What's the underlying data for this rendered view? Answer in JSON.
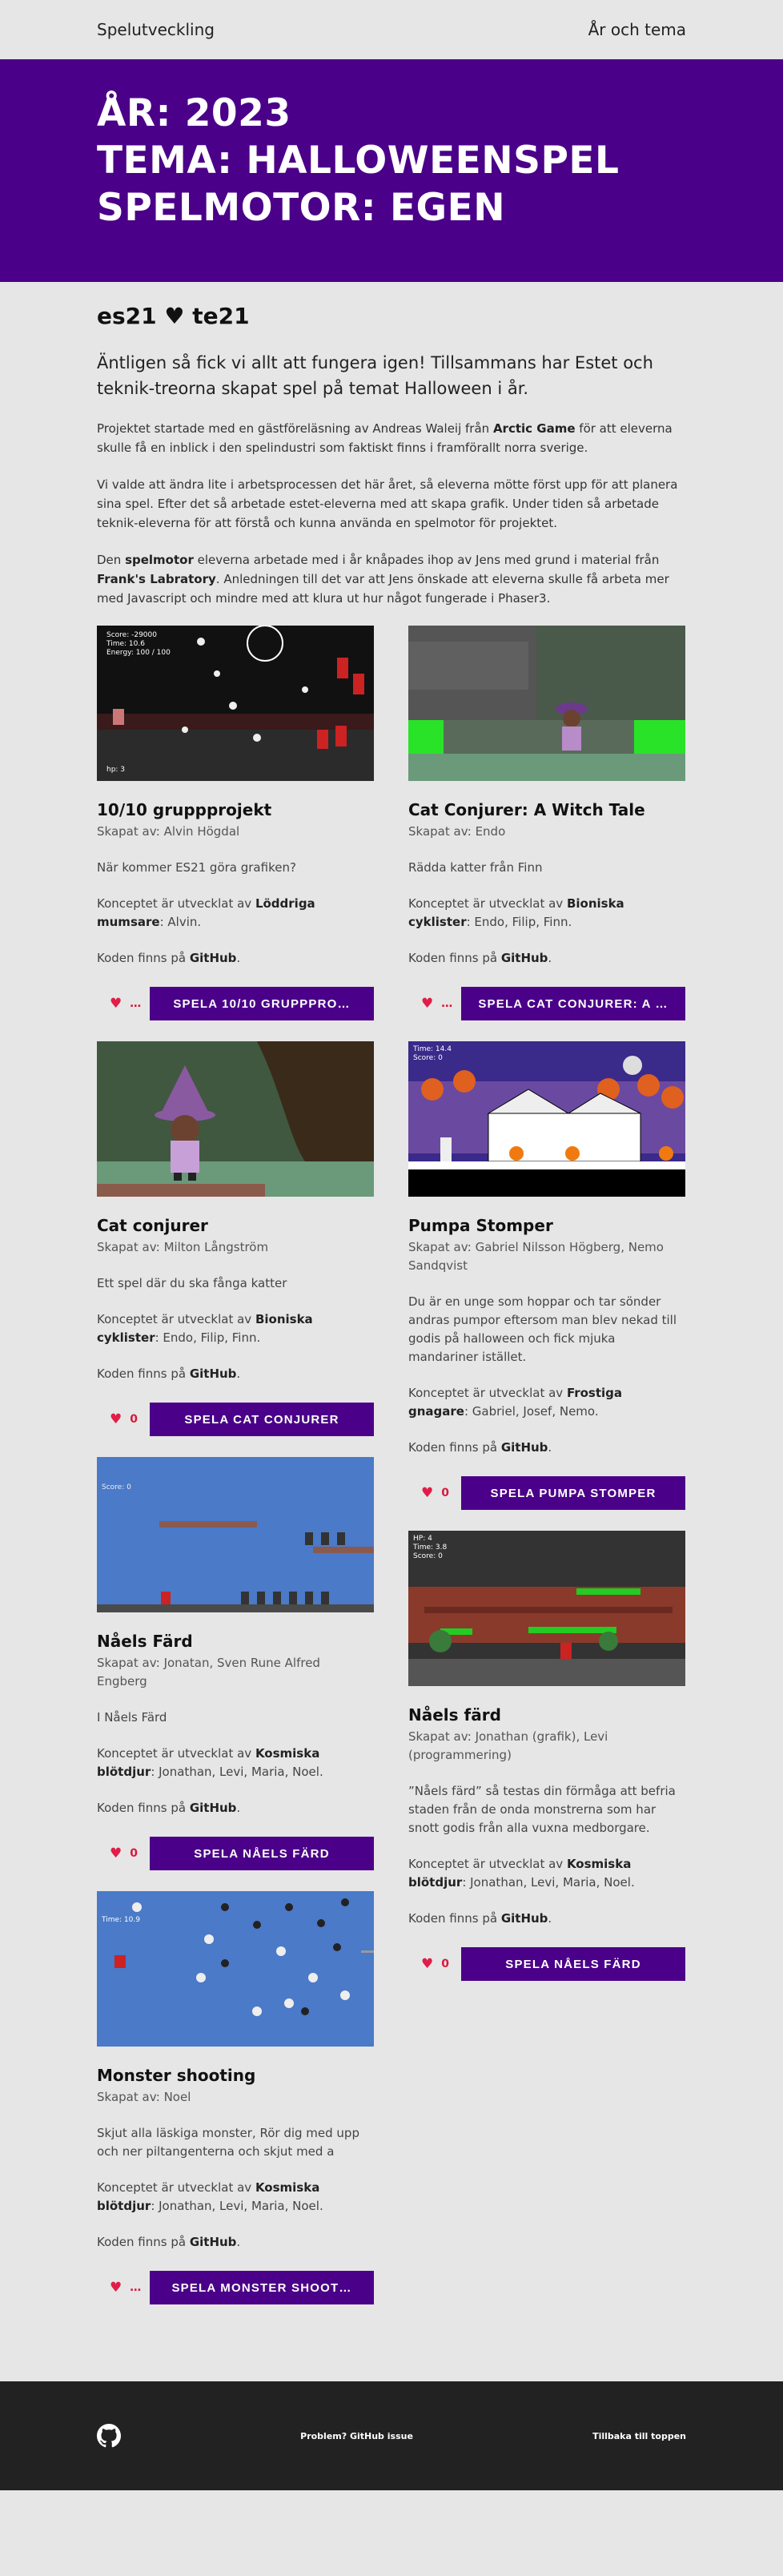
{
  "nav": {
    "brand": "Spelutveckling",
    "link": "År och tema"
  },
  "hero": {
    "line1": "ÅR: 2023",
    "line2": "TEMA: HALLOWEENSPEL",
    "line3": "SPELMOTOR: EGEN"
  },
  "intro": {
    "org": "es21 ♥ te21",
    "lead": "Äntligen så fick vi allt att fungera igen! Tillsammans har Estet och teknik-treorna skapat spel på temat Halloween i år.",
    "p1_a": "Projektet startade med en gästföreläsning av Andreas Waleij från ",
    "p1_b": "Arctic Game",
    "p1_c": " för att eleverna skulle få en inblick i den spelindustri som faktiskt finns i framförallt norra sverige.",
    "p2": "Vi valde att ändra lite i arbetsprocessen det här året, så eleverna möttе först upp för att planera sina spel. Efter det så arbetade estet-eleverna med att skapa grafik. Under tiden så arbetade teknik-eleverna för att förstå och kunna använda en spelmotor för projektet.",
    "p3_a": "Den ",
    "p3_b": "spelmotor",
    "p3_c": " eleverna arbetade med i år knåpades ihop av Jens med grund i material från ",
    "p3_d": "Frank's Labratory",
    "p3_e": ". Anledningen till det var att Jens önskade att eleverna skulle få arbeta mer med Javascript och mindre med att klura ut hur något fungerade i Phaser3."
  },
  "games": [
    {
      "title": "10/10 gruppprojekt",
      "author": "Skapat av: Alvin Högdal",
      "desc": "När kommer ES21 göra grafiken?",
      "concept_pre": "Konceptet är utvecklat av ",
      "concept_group": "Löddriga mumsare",
      "concept_names": ": Alvin.",
      "code_pre": "Koden finns på ",
      "code_link": "GitHub",
      "code_post": ".",
      "likes": "…",
      "play": "SPELA 10/10 GRUPPPRO…",
      "thumb_text": [
        "Score: -29000",
        "Time: 10.6",
        "Energy: 100 / 100",
        "hp: 3"
      ]
    },
    {
      "title": "Cat Conjurer: A Witch Tale",
      "author": "Skapat av: Endo",
      "desc": "Rädda katter från Finn",
      "concept_pre": "Konceptet är utvecklat av ",
      "concept_group": "Bioniska cyklister",
      "concept_names": ": Endo, Filip, Finn.",
      "code_pre": "Koden finns på ",
      "code_link": "GitHub",
      "code_post": ".",
      "likes": "…",
      "play": "SPELA CAT CONJURER: A …",
      "thumb_text": []
    },
    {
      "title": "Cat conjurer",
      "author": "Skapat av: Milton Långström",
      "desc": "Ett spel där du ska fånga katter",
      "concept_pre": "Konceptet är utvecklat av ",
      "concept_group": "Bioniska cyklister",
      "concept_names": ": Endo, Filip, Finn.",
      "code_pre": "Koden finns på ",
      "code_link": "GitHub",
      "code_post": ".",
      "likes": "0",
      "play": "SPELA CAT CONJURER",
      "thumb_text": []
    },
    {
      "title": "Pumpa Stomper",
      "author": "Skapat av: Gabriel Nilsson Högberg, Nemo Sandqvist",
      "desc": "Du är en unge som hoppar och tar sönder andras pumpor eftersom man blev nekad till godis på halloween och fick mjuka mandariner istället.",
      "concept_pre": "Konceptet är utvecklat av ",
      "concept_group": "Frostiga gnagare",
      "concept_names": ": Gabriel, Josef, Nemo.",
      "code_pre": "Koden finns på ",
      "code_link": "GitHub",
      "code_post": ".",
      "likes": "0",
      "play": "SPELA PUMPA STOMPER",
      "thumb_text": [
        "Time: 14.4",
        "Score: 0"
      ]
    },
    {
      "title": "Nåels Färd",
      "author": "Skapat av: Jonatan, Sven Rune Alfred Engberg",
      "desc": "I Nåels Färd",
      "concept_pre": "Konceptet är utvecklat av ",
      "concept_group": "Kosmiska blötdjur",
      "concept_names": ": Jonathan, Levi, Maria, Noel.",
      "code_pre": "Koden finns på ",
      "code_link": "GitHub",
      "code_post": ".",
      "likes": "0",
      "play": "SPELA NÅELS FÄRD",
      "thumb_text": [
        "Score: 0"
      ]
    },
    {
      "title": "Nåels färd",
      "author": "Skapat av: Jonathan (grafik), Levi (programmering)",
      "desc": "”Nåels färd” så testas din förmåga att befria staden från de onda monstrerna som har snott godis från alla vuxna medborgare.",
      "concept_pre": "Konceptet är utvecklat av ",
      "concept_group": "Kosmiska blötdjur",
      "concept_names": ": Jonathan, Levi, Maria, Noel.",
      "code_pre": "Koden finns på ",
      "code_link": "GitHub",
      "code_post": ".",
      "likes": "0",
      "play": "SPELA NÅELS FÄRD",
      "thumb_text": [
        "HP: 4",
        "Time: 3.8",
        "Score: 0"
      ]
    },
    {
      "title": "Monster shooting",
      "author": "Skapat av: Noel",
      "desc": "Skjut alla läskiga monster, Rör dig med upp och ner piltangenterna och skjut med a",
      "concept_pre": "Konceptet är utvecklat av ",
      "concept_group": "Kosmiska blötdjur",
      "concept_names": ": Jonathan, Levi, Maria, Noel.",
      "code_pre": "Koden finns på ",
      "code_link": "GitHub",
      "code_post": ".",
      "likes": "…",
      "play": "SPELA MONSTER SHOOT…",
      "thumb_text": [
        "Time: 10.9"
      ]
    }
  ],
  "footer": {
    "issue": "Problem? GitHub issue",
    "top": "Tillbaka till toppen"
  },
  "colors": {
    "accent": "#4a0088",
    "heart": "#e11d48",
    "footer": "#222222"
  }
}
